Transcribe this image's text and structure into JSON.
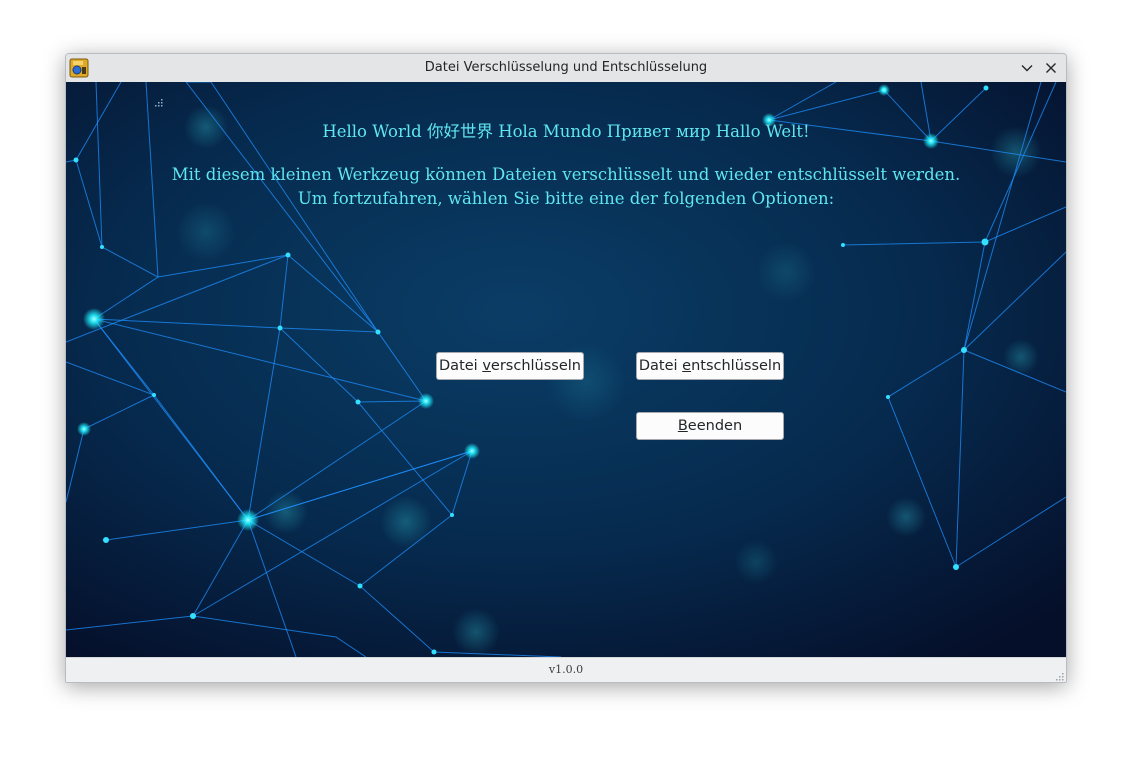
{
  "window": {
    "title": "Datei Verschlüsselung und Entschlüsselung",
    "app_icon": "lock-app-icon",
    "controls": {
      "minimize_icon": "chevron-down-icon",
      "close_icon": "close-icon"
    }
  },
  "main": {
    "greeting": "Hello World 你好世界 Hola Mundo Привет мир Hallo Welt!",
    "description_line1": "Mit diesem kleinen Werkzeug können Dateien verschlüsselt und wieder entschlüsselt werden.",
    "description_line2": "Um fortzufahren, wählen Sie bitte eine der folgenden Optionen:",
    "buttons": {
      "encrypt": {
        "before": "Datei ",
        "mnemonic": "v",
        "after": "erschlüsseln"
      },
      "decrypt": {
        "before": "Datei ",
        "mnemonic": "e",
        "after": "ntschlüsseln"
      },
      "quit": {
        "before": "",
        "mnemonic": "B",
        "after": "eenden"
      }
    }
  },
  "statusbar": {
    "version": "v1.0.0"
  },
  "colors": {
    "text_accent": "#5fe6f0",
    "background_dark": "#061d3b",
    "network_line": "#1e90ff",
    "network_node": "#22f0ff"
  }
}
